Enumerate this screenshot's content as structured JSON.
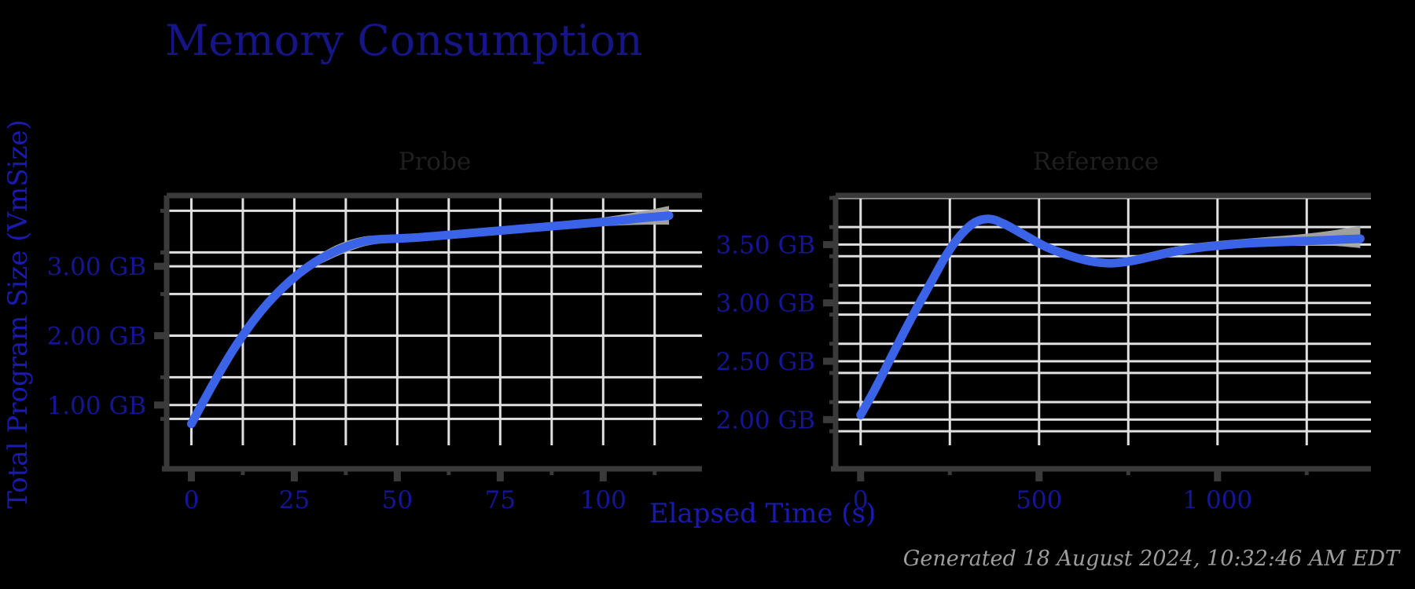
{
  "figure": {
    "title": "Memory Consumption",
    "background_color": "#000000",
    "title_color": "#151585",
    "axis_label_color": "#1a1ab0",
    "tick_color": "#151595",
    "line_color": "#3b63e8",
    "band_color": "#a9a9a9",
    "grid_color": "#e0e0e0",
    "frame_color": "#3a3a3a",
    "panel_title_color": "#1f1f1f",
    "footer_color": "#9d9d9d",
    "xlabel": "Elapsed Time (s)",
    "ylabel": "Total Program Size (VmSize)",
    "footer": "Generated 18 August 2024, 10:32:46 AM EDT"
  },
  "chart_data": [
    {
      "type": "line",
      "title": "Probe",
      "xlabel": "Elapsed Time (s)",
      "ylabel": "Total Program Size (VmSize)",
      "xlim": [
        -6,
        124
      ],
      "ylim": [
        0.42,
        4.02
      ],
      "xticks": [
        0,
        25,
        50,
        75,
        100
      ],
      "xtick_labels": [
        "0",
        "25",
        "50",
        "75",
        "100"
      ],
      "yticks": [
        1.0,
        2.0,
        3.0
      ],
      "ytick_labels": [
        "1.00 GB",
        "2.00 GB",
        "3.00 GB"
      ],
      "y_minor_gridlines": [
        0.8,
        1.4,
        2.0,
        2.6,
        3.2,
        3.8
      ],
      "x_minor_gridlines": [
        0,
        12.5,
        25,
        37.5,
        50,
        62.5,
        75,
        87.5,
        100,
        112.5
      ],
      "grid": true,
      "legend": "none",
      "series": [
        {
          "name": "VmSize",
          "x": [
            0,
            3,
            6,
            10,
            14,
            18,
            22,
            26,
            30,
            34,
            38,
            42,
            46,
            50,
            56,
            62,
            68,
            74,
            80,
            86,
            92,
            98,
            104,
            110,
            116
          ],
          "values": [
            0.73,
            1.06,
            1.38,
            1.78,
            2.13,
            2.43,
            2.68,
            2.89,
            3.06,
            3.19,
            3.29,
            3.36,
            3.39,
            3.4,
            3.42,
            3.45,
            3.48,
            3.51,
            3.54,
            3.57,
            3.6,
            3.63,
            3.66,
            3.7,
            3.73
          ]
        }
      ],
      "band": {
        "name": "uncertainty-band",
        "x": [
          0,
          3,
          6,
          10,
          14,
          18,
          22,
          26,
          30,
          34,
          38,
          42,
          46,
          50,
          56,
          62,
          68,
          74,
          80,
          86,
          92,
          98,
          104,
          110,
          116
        ],
        "upper": [
          0.74,
          1.07,
          1.4,
          1.81,
          2.16,
          2.47,
          2.73,
          2.95,
          3.13,
          3.27,
          3.37,
          3.43,
          3.45,
          3.46,
          3.48,
          3.5,
          3.53,
          3.56,
          3.59,
          3.62,
          3.65,
          3.69,
          3.74,
          3.8,
          3.87
        ],
        "lower": [
          0.72,
          1.05,
          1.36,
          1.75,
          2.1,
          2.39,
          2.63,
          2.83,
          2.99,
          3.11,
          3.21,
          3.29,
          3.33,
          3.34,
          3.36,
          3.4,
          3.43,
          3.46,
          3.49,
          3.52,
          3.55,
          3.57,
          3.59,
          3.6,
          3.6
        ]
      }
    },
    {
      "type": "line",
      "title": "Reference",
      "xlabel": "Elapsed Time (s)",
      "ylabel": "Total Program Size (VmSize)",
      "xlim": [
        -70,
        1430
      ],
      "ylim": [
        1.78,
        3.92
      ],
      "xticks": [
        0,
        500,
        1000
      ],
      "xtick_labels": [
        "0",
        "500",
        "1 000"
      ],
      "yticks": [
        2.0,
        2.5,
        3.0,
        3.5
      ],
      "ytick_labels": [
        "2.00 GB",
        "2.50 GB",
        "3.00 GB",
        "3.50 GB"
      ],
      "y_minor_gridlines": [
        1.9,
        2.15,
        2.4,
        2.65,
        2.9,
        3.15,
        3.4,
        3.65,
        3.9
      ],
      "x_minor_gridlines": [
        0,
        250,
        500,
        750,
        1000,
        1250
      ],
      "grid": true,
      "legend": "none",
      "series": [
        {
          "name": "VmSize",
          "x": [
            0,
            40,
            80,
            120,
            160,
            200,
            240,
            280,
            320,
            360,
            400,
            460,
            520,
            580,
            640,
            700,
            760,
            820,
            880,
            940,
            1000,
            1080,
            1160,
            1240,
            1320,
            1400
          ],
          "values": [
            2.04,
            2.26,
            2.5,
            2.74,
            2.97,
            3.19,
            3.41,
            3.58,
            3.69,
            3.72,
            3.68,
            3.58,
            3.48,
            3.41,
            3.36,
            3.34,
            3.36,
            3.4,
            3.44,
            3.47,
            3.49,
            3.51,
            3.52,
            3.53,
            3.54,
            3.55
          ]
        }
      ],
      "band": {
        "name": "uncertainty-band",
        "x": [
          0,
          40,
          80,
          120,
          160,
          200,
          240,
          280,
          320,
          360,
          400,
          460,
          520,
          580,
          640,
          700,
          760,
          820,
          880,
          940,
          1000,
          1080,
          1160,
          1240,
          1320,
          1400
        ],
        "upper": [
          2.05,
          2.27,
          2.51,
          2.75,
          2.98,
          3.21,
          3.43,
          3.61,
          3.72,
          3.75,
          3.71,
          3.61,
          3.51,
          3.44,
          3.39,
          3.37,
          3.4,
          3.44,
          3.48,
          3.51,
          3.53,
          3.55,
          3.57,
          3.59,
          3.62,
          3.66
        ],
        "lower": [
          2.03,
          2.25,
          2.49,
          2.73,
          2.95,
          3.17,
          3.39,
          3.56,
          3.67,
          3.7,
          3.66,
          3.56,
          3.45,
          3.38,
          3.33,
          3.31,
          3.33,
          3.37,
          3.41,
          3.44,
          3.46,
          3.48,
          3.49,
          3.49,
          3.49,
          3.47
        ]
      }
    }
  ]
}
